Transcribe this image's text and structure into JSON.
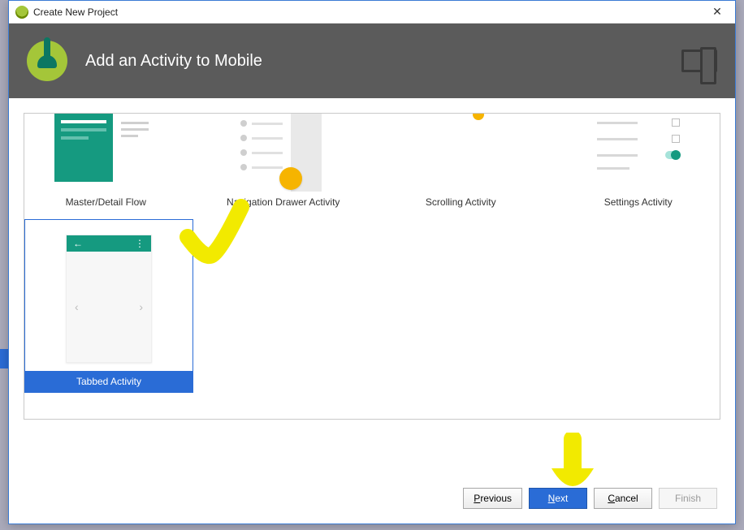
{
  "window": {
    "title": "Create New Project",
    "close_glyph": "✕"
  },
  "banner": {
    "heading": "Add an Activity to Mobile"
  },
  "templates": {
    "row1": [
      {
        "label": "Master/Detail Flow"
      },
      {
        "label": "Navigation Drawer Activity"
      },
      {
        "label": "Scrolling Activity"
      },
      {
        "label": "Settings Activity"
      }
    ],
    "row2": [
      {
        "label": "Tabbed Activity",
        "selected": true
      }
    ]
  },
  "tabbed_preview": {
    "back_glyph": "←",
    "menu_glyph": "⋮",
    "left_glyph": "‹",
    "right_glyph": "›"
  },
  "buttons": {
    "previous": "Previous",
    "next": "Next",
    "cancel": "Cancel",
    "finish": "Finish"
  },
  "colors": {
    "accent": "#2a6cd6",
    "teal": "#159a80",
    "amber": "#f6b400",
    "annotation": "#f2ea00"
  }
}
